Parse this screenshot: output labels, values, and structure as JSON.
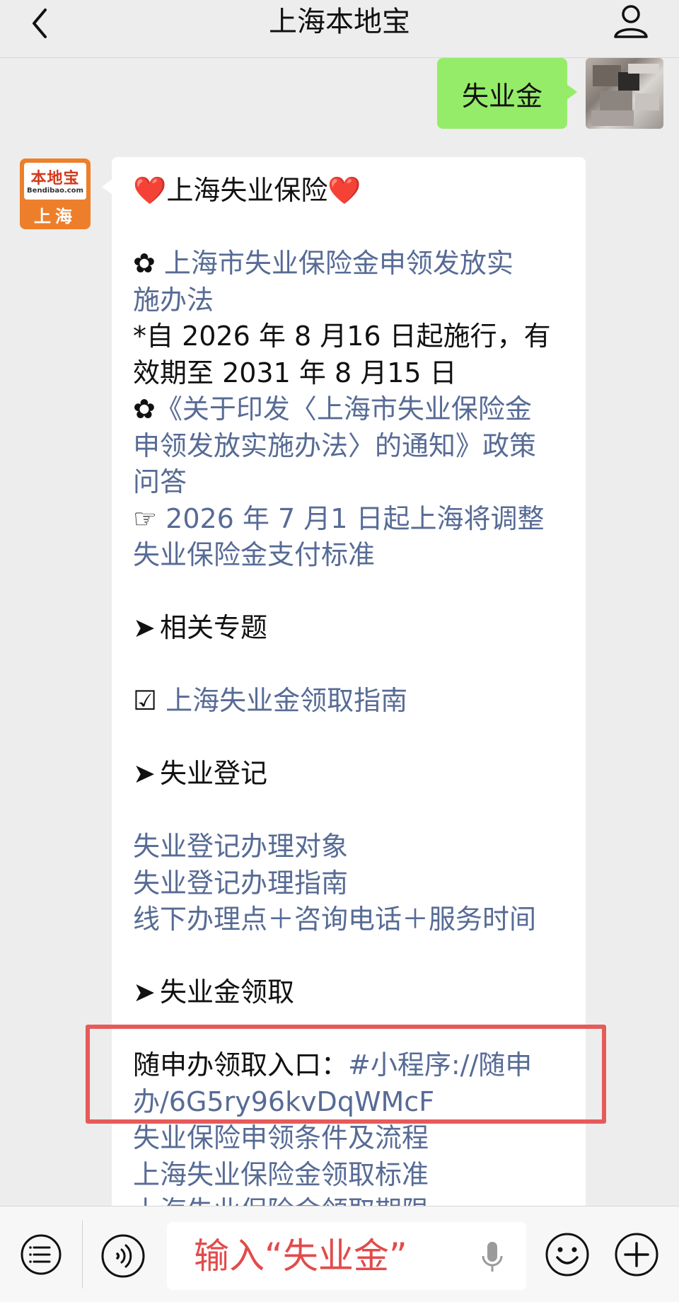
{
  "header": {
    "title": "上海本地宝",
    "back_icon": "chevron-left-icon",
    "profile_icon": "person-icon"
  },
  "user_message": {
    "text": "失业金"
  },
  "bot_avatar": {
    "logo_main": "本地宝",
    "logo_sub": "Bendibao.com",
    "logo_city": "上海"
  },
  "bot_message": {
    "title_heart_left": "❤️",
    "title": "上海失业保险",
    "title_heart_right": "❤️",
    "flower1": "✿ ",
    "link1_line1": "上海市失业保险金申领发放实",
    "link1_line2": "施办法",
    "note_line1": "*自 2026 年 8 月16 日起施行，有",
    "note_line2": "效期至 2031 年 8 月15 日",
    "flower2": "✿",
    "link2_line1": "《关于印发〈上海市失业保险金",
    "link2_line2": "申领发放实施办法〉的通知》政策",
    "link2_line3": "问答",
    "hand": "☞ ",
    "link3_line1": "2026 年 7 月1 日起上海将调整",
    "link3_line2": "失业保险金支付标准",
    "section1_arrow": "➤",
    "section1": "相关专题",
    "checkbox": "☑ ",
    "link4": "上海失业金领取指南",
    "section2_arrow": "➤",
    "section2": "失业登记",
    "link5": "失业登记办理对象",
    "link6": "失业登记办理指南",
    "link7": "线下办理点＋咨询电话＋服务时间",
    "section3_arrow": "➤",
    "section3": "失业金领取",
    "entry_label": "随申办领取入口：",
    "entry_link_line1": "#小程序://随申",
    "entry_link_line2": "办/6G5ry96kvDqWMcF",
    "link8": "失业保险申领条件及流程",
    "link9": "上海失业保险金领取标准",
    "link10": "上海失业保险金领取期限"
  },
  "input_bar": {
    "text": "输入“失业金”",
    "menu_icon": "menu-icon",
    "voice_icon": "voice-icon",
    "mic_icon": "microphone-icon",
    "emoji_icon": "emoji-icon",
    "plus_icon": "plus-icon"
  },
  "colors": {
    "link": "#576b95",
    "bubble_user": "#95ec69",
    "highlight": "#e65a5a",
    "background": "#ededed"
  }
}
